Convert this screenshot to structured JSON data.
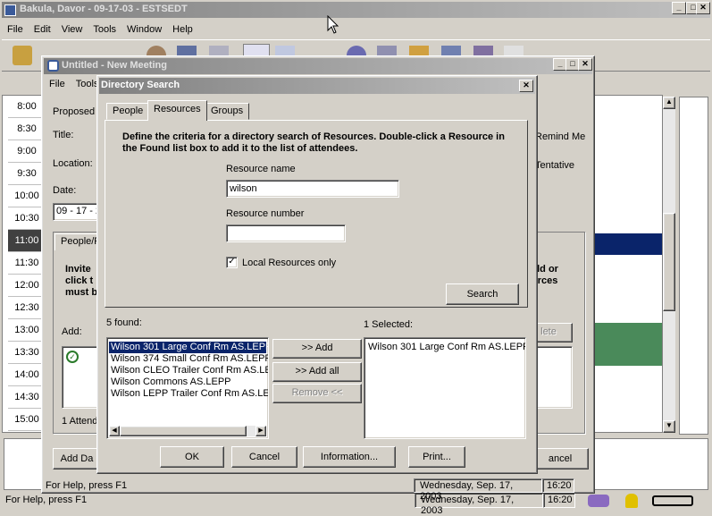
{
  "main_window": {
    "title": "Bakula, Davor - 09-17-03 - ESTSEDT",
    "menu": [
      "File",
      "Edit",
      "View",
      "Tools",
      "Window",
      "Help"
    ],
    "times": [
      "8:00",
      "8:30",
      "9:00",
      "9:30",
      "10:00",
      "10:30",
      "11:00",
      "11:30",
      "12:00",
      "12:30",
      "13:00",
      "13:30",
      "14:00",
      "14:30",
      "15:00"
    ],
    "selected_time": "11:00",
    "status_left": "For Help, press F1",
    "status_date": "Wednesday, Sep. 17, 2003",
    "status_time": "16:20"
  },
  "meeting_window": {
    "title": "Untitled - New Meeting",
    "menu": [
      "File",
      "Tools"
    ],
    "proposed_label": "Proposed I",
    "title_label": "Title:",
    "location_label": "Location:",
    "date_label": "Date:",
    "date_value": "09 - 17 - 2",
    "remind_me": "Remind Me",
    "tentative": "Tentative",
    "people_tab": "People/F",
    "invite_text": "Invite\nclick t\nmust b",
    "right_text": "eld or\nurces",
    "add_label": "Add:",
    "delete_label": "lete",
    "attend_text": "1 Attend",
    "add_da_button": "Add Da",
    "cancel_button": "ancel",
    "status_left": "For Help, press F1",
    "status_date": "Wednesday, Sep. 17, 2003",
    "status_time": "16:20"
  },
  "dialog": {
    "title": "Directory Search",
    "tabs": [
      "People",
      "Resources",
      "Groups"
    ],
    "active_tab": "Resources",
    "instructions": "Define the criteria for a directory search of Resources. Double-click a Resource in the Found list box to add it to the list of attendees.",
    "resource_name_label": "Resource name",
    "resource_name_value": "wilson",
    "resource_number_label": "Resource number",
    "resource_number_value": "",
    "local_only_label": "Local Resources only",
    "local_only_checked": true,
    "search_button": "Search",
    "found_label": "5 found:",
    "found_items": [
      "Wilson 301 Large Conf Rm AS.LEPP",
      "Wilson 374 Small Conf Rm AS.LEPP",
      "Wilson CLEO Trailer Conf Rm AS.LEPP",
      "Wilson Commons AS.LEPP",
      "Wilson LEPP Trailer Conf Rm AS.LEPP"
    ],
    "selected_label": "1 Selected:",
    "selected_items": [
      "Wilson 301 Large Conf Rm AS.LEPP"
    ],
    "add_button": ">> Add",
    "add_all_button": ">> Add all",
    "remove_button": "Remove <<",
    "ok_button": "OK",
    "cancel_button": "Cancel",
    "information_button": "Information...",
    "print_button": "Print..."
  }
}
